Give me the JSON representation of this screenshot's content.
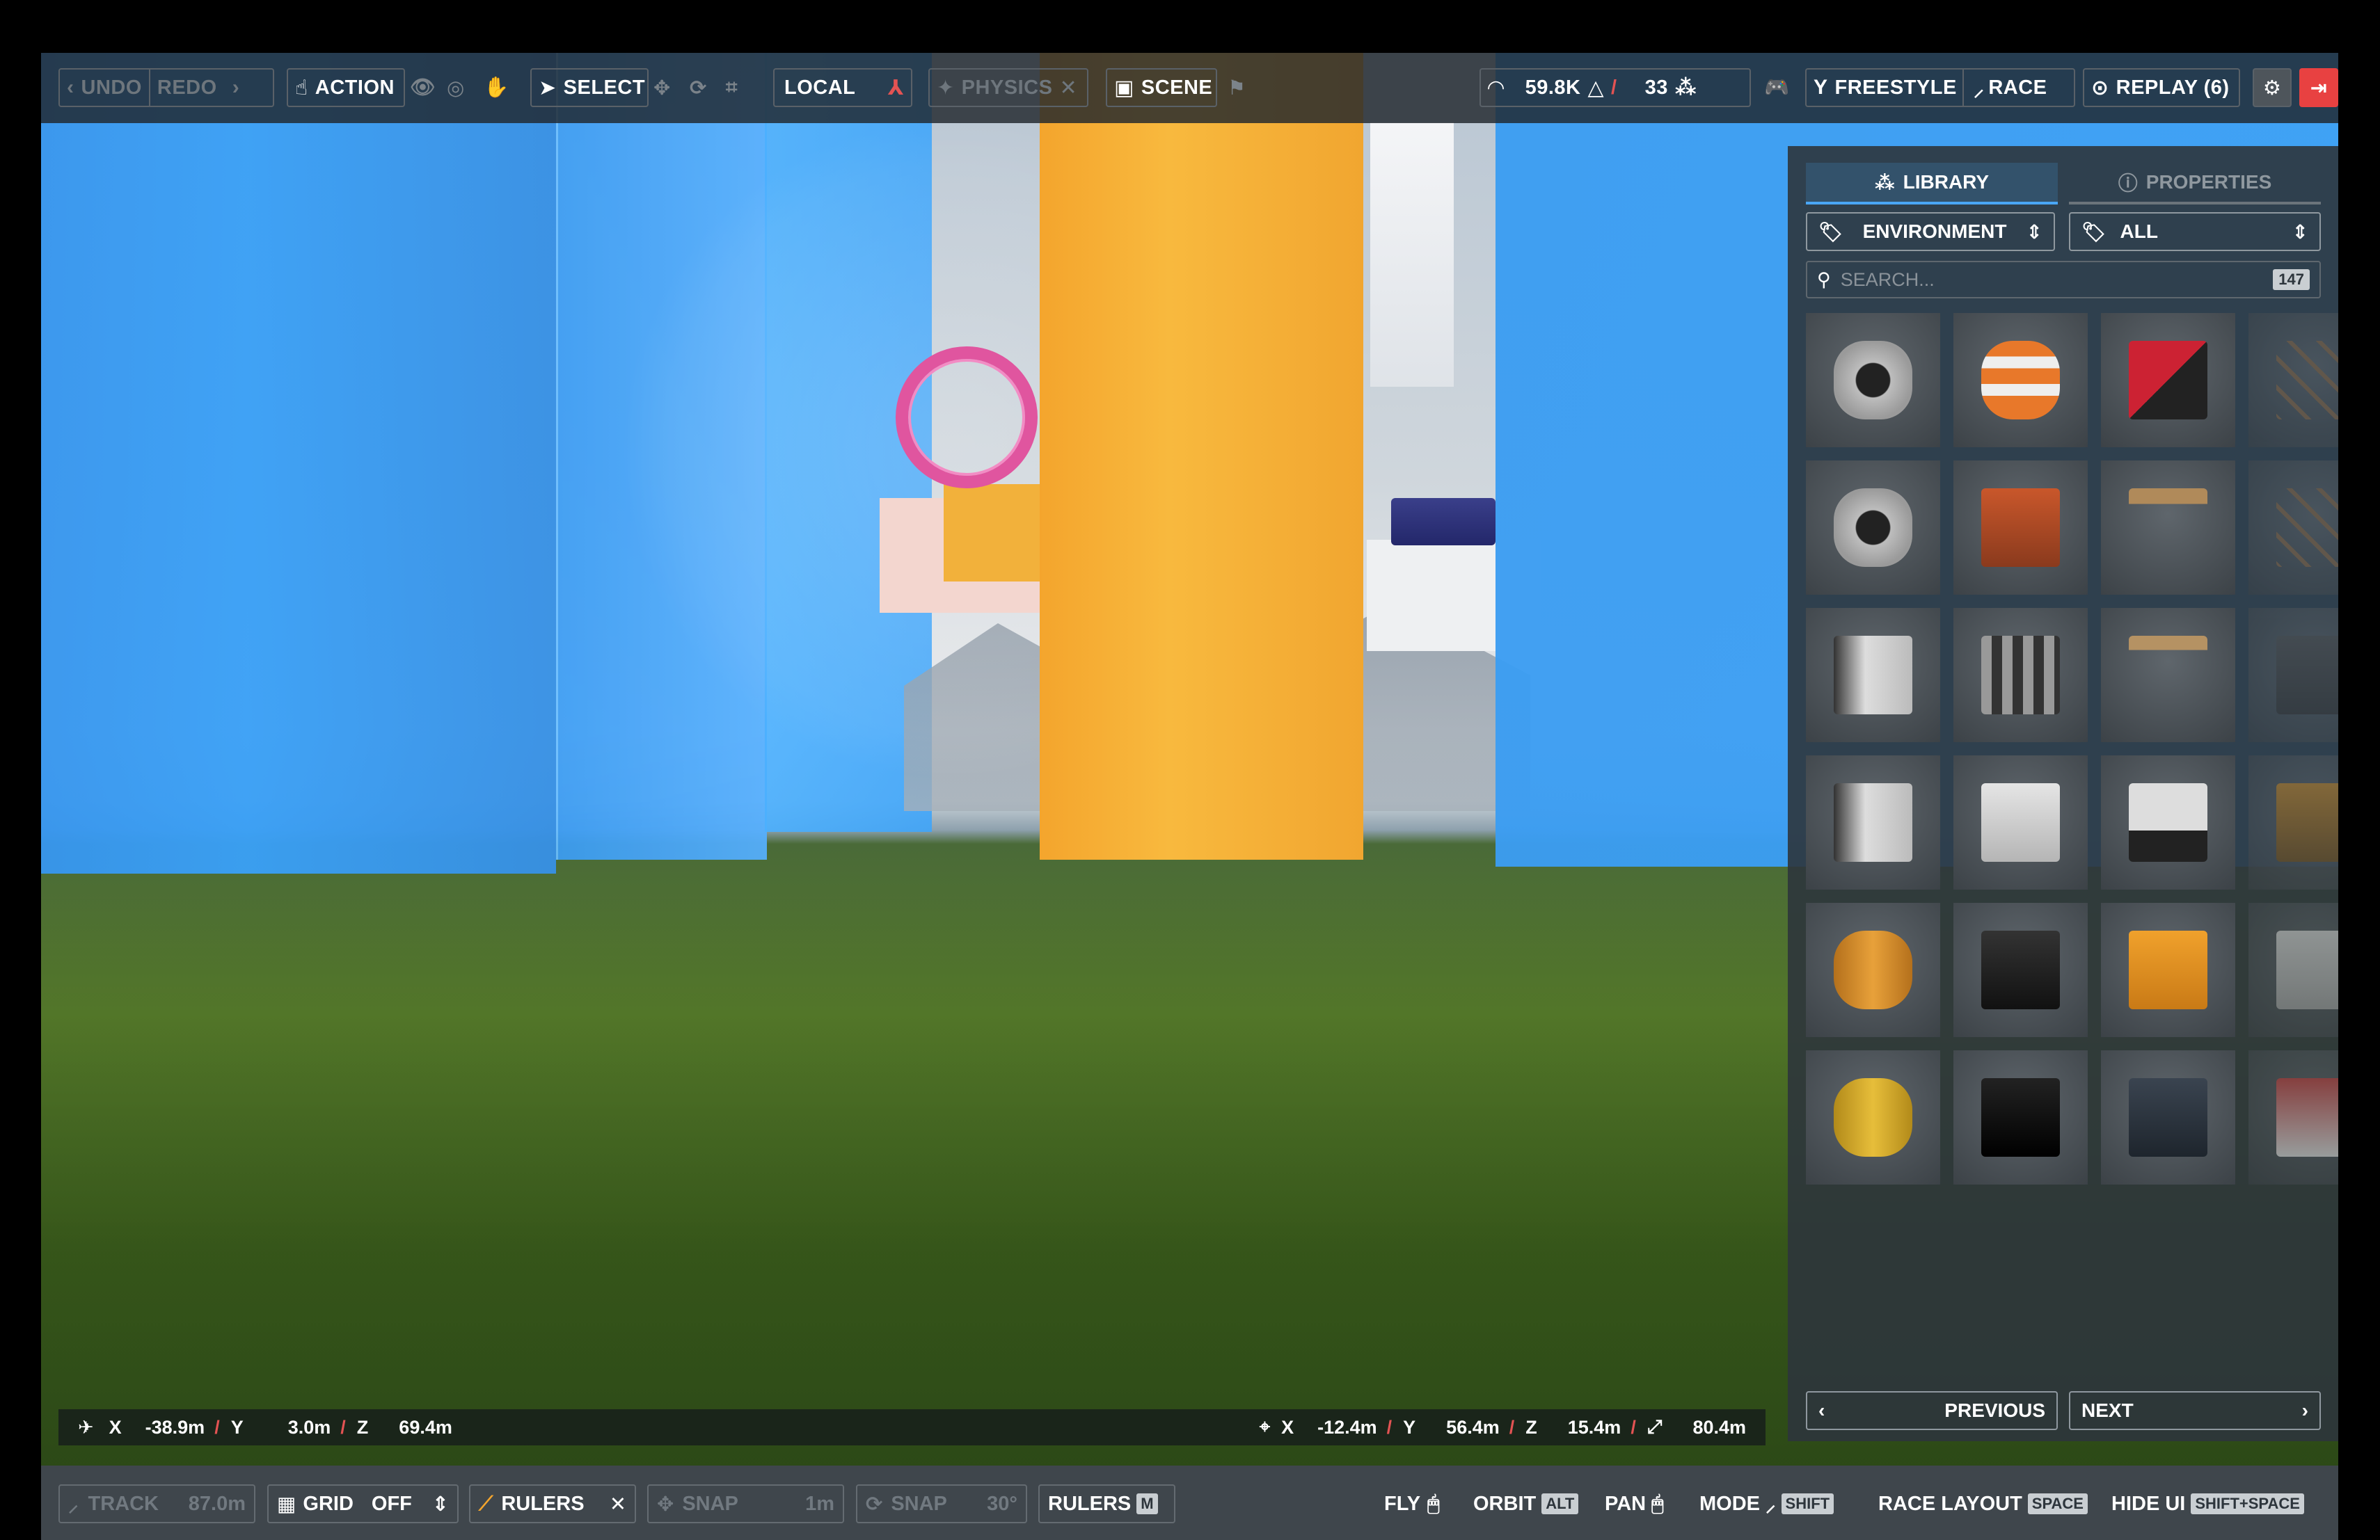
{
  "toolbar": {
    "undo": "UNDO",
    "redo": "REDO",
    "action": "ACTION",
    "select": "SELECT",
    "local": "LOCAL",
    "physics": "PHYSICS",
    "scene": "SCENE",
    "stat_poly": "59.8K",
    "stat_objects": "33",
    "freestyle": "FREESTYLE",
    "race": "RACE",
    "replay": "REPLAY (6)"
  },
  "panel": {
    "tab_library": "LIBRARY",
    "tab_properties": "PROPERTIES",
    "category": "ENVIRONMENT",
    "filter": "ALL",
    "search_placeholder": "SEARCH...",
    "search_count": "147",
    "previous": "PREVIOUS",
    "next": "NEXT",
    "items": [
      "turbine-engine",
      "traffic-barrel",
      "drl-platform",
      "scaffold",
      "turbine-engine",
      "road-barrier",
      "bench",
      "scaffold",
      "fuselage",
      "concrete-barrier",
      "table",
      "crate",
      "fuselage",
      "ibc-tank",
      "drl-billboard",
      "crane",
      "oil-drum",
      "metal-beam",
      "drl-container",
      "drl-banner",
      "yellow-drum",
      "black-case",
      "cargo-container",
      "drl-sign"
    ]
  },
  "coords": {
    "drone_x_label": "X",
    "drone_x": "-38.9m",
    "drone_y_label": "Y",
    "drone_y": "3.0m",
    "drone_z_label": "Z",
    "drone_z": "69.4m",
    "target_x_label": "X",
    "target_x": "-12.4m",
    "target_y_label": "Y",
    "target_y": "56.4m",
    "target_z_label": "Z",
    "target_z": "15.4m",
    "distance": "80.4m"
  },
  "bottombar": {
    "track": "TRACK",
    "track_length": "87.0m",
    "grid": "GRID",
    "grid_value": "OFF",
    "rulers": "RULERS",
    "snap_move": "SNAP",
    "snap_move_value": "1m",
    "snap_rotate": "SNAP",
    "snap_rotate_value": "30°",
    "rulers_m": "RULERS",
    "rulers_m_key": "M",
    "fly": "FLY",
    "orbit": "ORBIT",
    "orbit_key": "ALT",
    "pan": "PAN",
    "mode": "MODE",
    "mode_key": "SHIFT",
    "race_layout": "RACE LAYOUT",
    "race_layout_key": "SPACE",
    "hide_ui": "HIDE UI",
    "hide_ui_key": "SHIFT+SPACE"
  },
  "colors": {
    "accent": "#4aa6f5",
    "danger": "#e84141",
    "pillar": "#f4a52d",
    "wall": "#3a9ff5"
  }
}
